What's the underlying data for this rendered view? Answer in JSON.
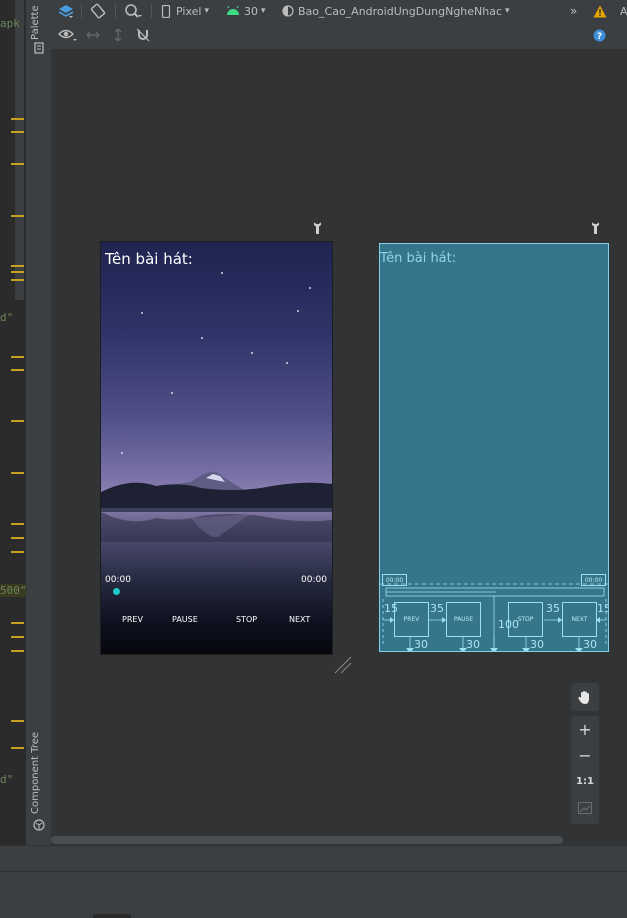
{
  "gutter": {
    "frag_apk": "apk",
    "frag_d1": "d\"",
    "frag_500": "500\"",
    "frag_d2": "d\""
  },
  "side_tabs": {
    "palette": "Palette",
    "component_tree": "Component Tree"
  },
  "toolbar": {
    "device": "Pixel",
    "api_level": "30",
    "theme": "Bao_Cao_AndroidUngDungNgheNhac",
    "overflow": "»",
    "overflow_trailing": "A"
  },
  "icons": {
    "layers": "layers-icon",
    "orientation": "rotate-icon",
    "night_mode": "magnifier-icon",
    "device": "phone-icon",
    "api": "android-icon",
    "theme": "globe-icon",
    "warning": "warning-icon",
    "view_options": "eye-icon",
    "help": "help-icon"
  },
  "colors": {
    "accent_teal": "#1fc8c8",
    "warning": "#e5a400",
    "blueprint_bg": "#36758a",
    "android_green": "#3ddc84"
  },
  "design": {
    "title": "Tên bài hát:",
    "time_left": "00:00",
    "time_right": "00:00",
    "buttons": {
      "prev": "PREV",
      "pause": "PAUSE",
      "stop": "STOP",
      "next": "NEXT"
    }
  },
  "blueprint": {
    "title": "Tên bài hát:",
    "time_left": "00:00",
    "time_right": "00:00",
    "buttons": {
      "prev": "PREV",
      "pause": "PAUSE",
      "stop": "STOP",
      "next": "NEXT"
    },
    "margins": {
      "left": "15",
      "prev_pause": "35",
      "stop_next": "35",
      "right": "15",
      "bottom_prev": "30",
      "bottom_pause": "30",
      "bottom_stop": "30",
      "bottom_next": "30",
      "center": "100"
    }
  },
  "zoom": {
    "zoom_in": "+",
    "zoom_out": "−",
    "actual_size": "1:1"
  }
}
